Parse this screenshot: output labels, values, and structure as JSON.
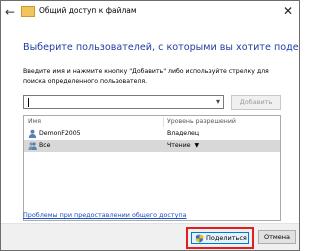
{
  "window": {
    "title": "Общий доступ к файлам",
    "heading": "Выберите пользователей, с которыми вы хотите поделиться",
    "description": "Введите имя и нажмите кнопку \"Добавить\" либо используйте стрелку для поиска определенного пользователя."
  },
  "input": {
    "value": ""
  },
  "add_button": {
    "label": "Добавить"
  },
  "table": {
    "headers": {
      "name": "Имя",
      "permission": "Уровень разрешений"
    },
    "rows": [
      {
        "name": "DemonF2005",
        "permission": "Владелец",
        "selected": false
      },
      {
        "name": "Все",
        "permission": "Чтение",
        "selected": true
      }
    ]
  },
  "link": {
    "text": "Проблемы при предоставлении общего доступа"
  },
  "buttons": {
    "share": "Поделиться",
    "cancel": "Отмена"
  }
}
